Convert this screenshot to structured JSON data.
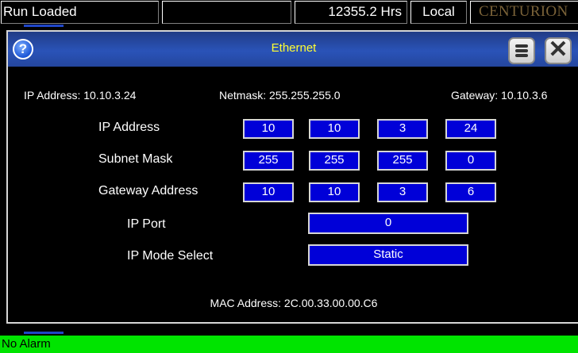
{
  "topbar": {
    "status": "Run Loaded",
    "hours": "12355.2 Hrs",
    "mode": "Local",
    "brand": "CENTURION"
  },
  "dialog": {
    "title": "Ethernet",
    "help_icon": "?",
    "close_icon": "✕",
    "summary": {
      "ip": "IP Address: 10.10.3.24",
      "netmask": "Netmask: 255.255.255.0",
      "gateway": "Gateway: 10.10.3.6"
    },
    "rows": {
      "ip_address": {
        "label": "IP Address",
        "octets": [
          "10",
          "10",
          "3",
          "24"
        ]
      },
      "subnet_mask": {
        "label": "Subnet Mask",
        "octets": [
          "255",
          "255",
          "255",
          "0"
        ]
      },
      "gateway_address": {
        "label": "Gateway Address",
        "octets": [
          "10",
          "10",
          "3",
          "6"
        ]
      },
      "ip_port": {
        "label": "IP Port",
        "value": "0"
      },
      "ip_mode": {
        "label": "IP Mode Select",
        "value": "Static"
      }
    },
    "mac": "MAC Address: 2C.00.33.00.00.C6"
  },
  "alarm": {
    "text": "No Alarm"
  },
  "colors": {
    "field_blue": "#0000d8",
    "title_yellow": "#ffff33",
    "alarm_green": "#00e400",
    "brand_gold": "#7a6238"
  }
}
